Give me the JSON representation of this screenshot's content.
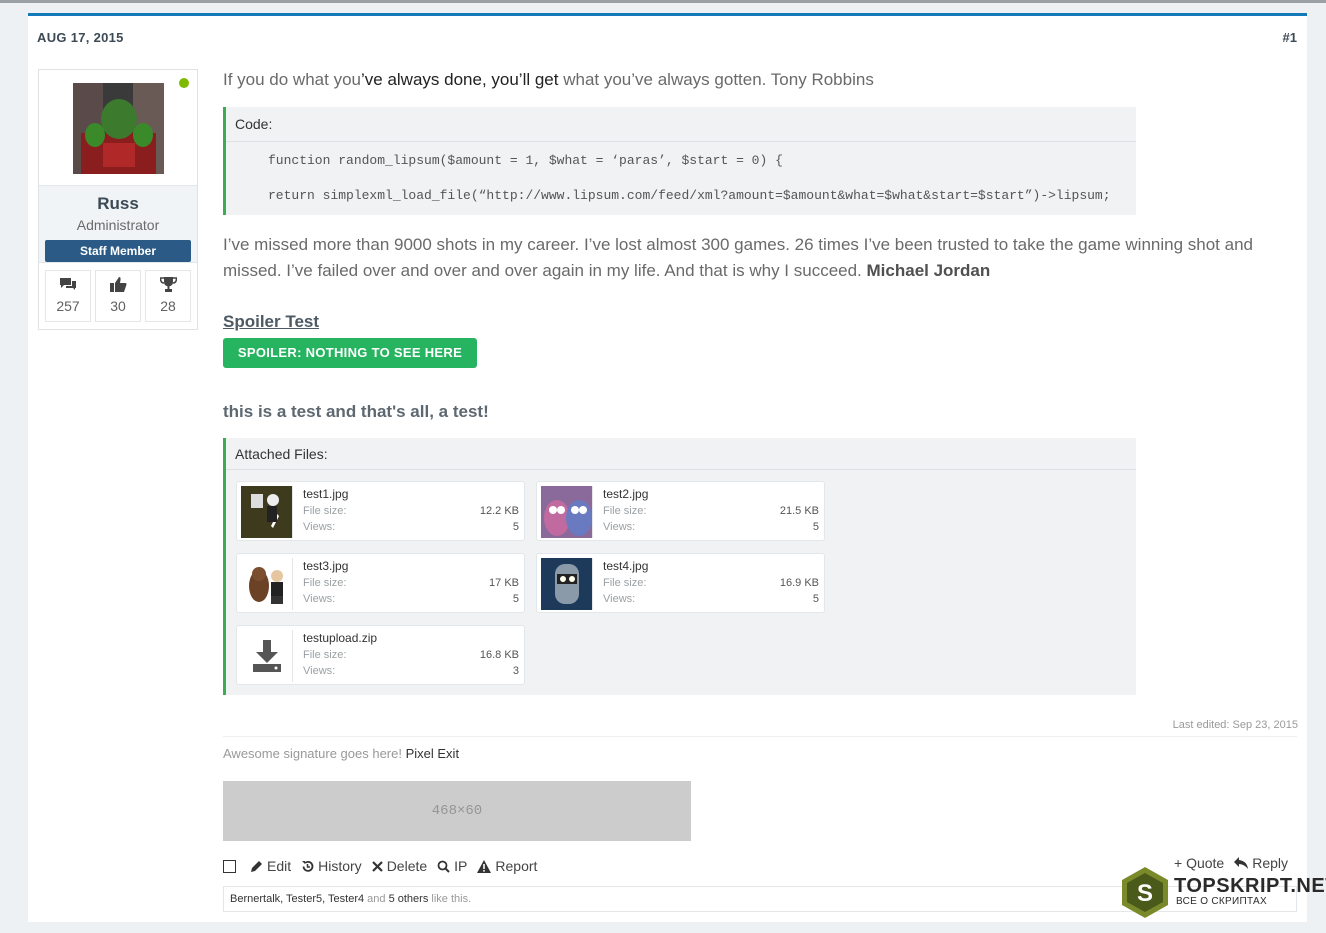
{
  "post": {
    "date": "AUG 17, 2015",
    "number": "#1"
  },
  "user": {
    "name": "Russ",
    "title": "Administrator",
    "badge": "Staff Member",
    "stats": {
      "messages": "257",
      "likes": "30",
      "points": "28"
    }
  },
  "body": {
    "quote_a": "If you do what you",
    "quote_b": "’ve always done, you’ll get",
    "quote_c": " what you’ve always gotten. Tony Robbins",
    "code": {
      "label": "Code:",
      "line1": "function random_lipsum($amount = 1, $what = ‘paras’, $start = 0) {",
      "line2": "return simplexml_load_file(“http://www.lipsum.com/feed/xml?amount=$amount&what=$what&start=$start”)->lipsum;"
    },
    "paragraph": "I’ve missed more than 9000 shots in my career. I’ve lost almost 300 games. 26 times I’ve been trusted to take the game winning shot and missed. I’ve failed over and over and over again in my life. And that is why I succeed. ",
    "paragraph_author": "Michael Jordan",
    "spoiler_title": "Spoiler Test",
    "spoiler_button": "SPOILER: NOTHING TO SEE HERE",
    "test_line": "this is a test and that's all, a test!"
  },
  "attachments": {
    "label": "Attached Files:",
    "size_label": "File size:",
    "views_label": "Views:",
    "files": [
      {
        "name": "test1.jpg",
        "size": "12.2 KB",
        "views": "5"
      },
      {
        "name": "test2.jpg",
        "size": "21.5 KB",
        "views": "5"
      },
      {
        "name": "test3.jpg",
        "size": "17 KB",
        "views": "5"
      },
      {
        "name": "test4.jpg",
        "size": "16.9 KB",
        "views": "5"
      },
      {
        "name": "testupload.zip",
        "size": "16.8 KB",
        "views": "3"
      }
    ]
  },
  "footer": {
    "last_edited": "Last edited: Sep 23, 2015",
    "signature_text": "Awesome signature goes here! ",
    "signature_link": "Pixel Exit",
    "banner_text": "468×60",
    "actions": {
      "edit": "Edit",
      "history": "History",
      "delete": "Delete",
      "ip": "IP",
      "report": "Report",
      "quote": "+ Quote",
      "reply": "Reply"
    },
    "likes": {
      "users": "Bernertalk, Tester5, Tester4",
      "and": " and ",
      "others": "5 others",
      "suffix": " like this."
    }
  },
  "watermark": {
    "title": "TOPSKRIPT.NET",
    "subtitle": "ВСЕ О СКРИПТАХ",
    "letter": "S"
  },
  "colors": {
    "accent_blue": "#1479b8",
    "staff_badge": "#2a5a85",
    "spoiler_green": "#27b460",
    "block_border_green": "#3dab54",
    "online_dot": "#7fb900"
  }
}
